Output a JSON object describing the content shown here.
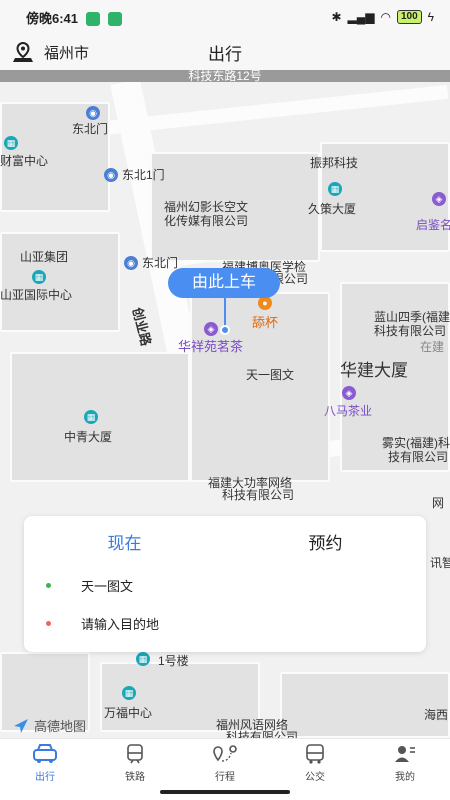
{
  "status": {
    "time": "傍晚6:41",
    "battery": "100"
  },
  "header": {
    "city": "福州市",
    "title": "出行"
  },
  "address_banner": "科技东路12号",
  "map": {
    "road_labels": [
      "创业路"
    ],
    "pois": [
      "东北门",
      "财富中心",
      "东北1门",
      "振邦科技",
      "福州幻影长空文",
      "化传媒有限公司",
      "久策大厦",
      "启鉴名",
      "山亚集团",
      "东北门",
      "福建博奥医学检",
      "验所有限公司",
      "山亚国际中心",
      "舔杯",
      "华祥苑茗茶",
      "蓝山四季(福建",
      "科技有限公司",
      "在建",
      "天一图文",
      "八马茶业",
      "中青大厦",
      "雾实(福建)科",
      "技有限公司",
      "福建大功率网络",
      "科技有限公司",
      "网",
      "讯智",
      "1号楼",
      "万福中心",
      "福州风语网络",
      "科技有限公司",
      "海西"
    ],
    "big_label": "华建大厦",
    "pickup_label": "由此上车"
  },
  "panel": {
    "tabs": [
      "现在",
      "预约"
    ],
    "active_tab": 0,
    "origin": "天一图文",
    "destination_placeholder": "请输入目的地",
    "origin_color": "#3fb34f",
    "destination_color": "#f0645a"
  },
  "watermark": "高德地图",
  "tabbar": {
    "items": [
      {
        "label": "出行",
        "icon": "taxi-icon",
        "active": true
      },
      {
        "label": "铁路",
        "icon": "train-icon",
        "active": false
      },
      {
        "label": "行程",
        "icon": "route-icon",
        "active": false
      },
      {
        "label": "公交",
        "icon": "bus-icon",
        "active": false
      },
      {
        "label": "我的",
        "icon": "profile-icon",
        "active": false
      }
    ]
  },
  "colors": {
    "accent": "#3a7be0",
    "pickup": "#4b8ef2"
  }
}
